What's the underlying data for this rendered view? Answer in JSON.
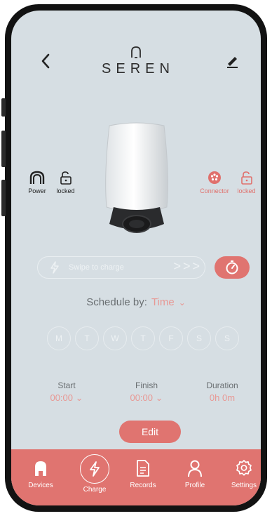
{
  "header": {
    "brand": "SEREN"
  },
  "status_left": {
    "power_label": "Power",
    "lock_label": "locked"
  },
  "status_right": {
    "connector_label": "Connector",
    "lock_label": "locked"
  },
  "swipe": {
    "label": "Swipe to charge",
    "arrows": "> > >"
  },
  "schedule": {
    "label": "Schedule by:",
    "value": "Time"
  },
  "days": [
    "M",
    "T",
    "W",
    "T",
    "F",
    "S",
    "S"
  ],
  "times": {
    "start_label": "Start",
    "start_value": "00:00",
    "finish_label": "Finish",
    "finish_value": "00:00",
    "duration_label": "Duration",
    "duration_value": "0h 0m"
  },
  "edit_label": "Edit",
  "tabs": [
    {
      "label": "Devices",
      "icon": "charger-icon"
    },
    {
      "label": "Charge",
      "icon": "bolt-icon"
    },
    {
      "label": "Records",
      "icon": "document-icon"
    },
    {
      "label": "Profile",
      "icon": "person-icon"
    },
    {
      "label": "Settings",
      "icon": "gear-icon"
    }
  ],
  "colors": {
    "accent": "#e07470",
    "background": "#d6dee3",
    "accent_light": "#e89894"
  }
}
